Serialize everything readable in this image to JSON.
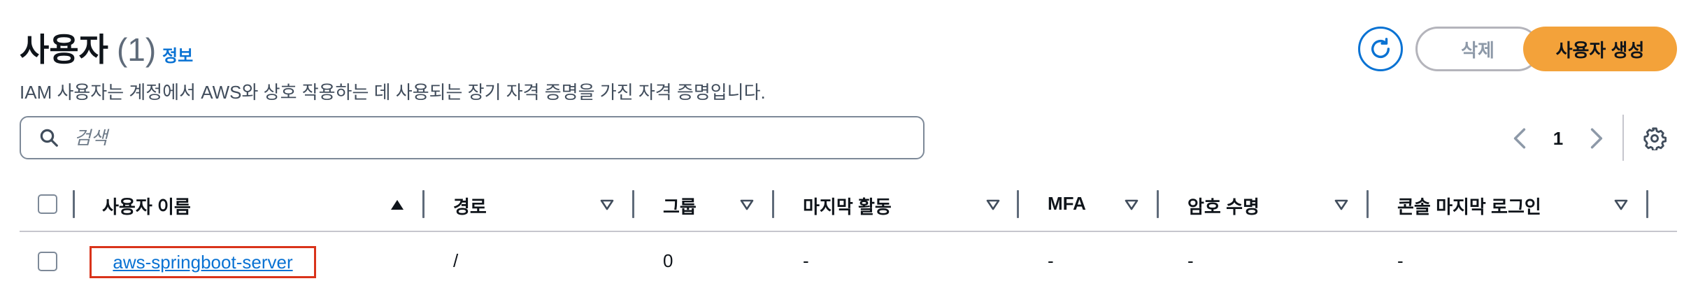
{
  "header": {
    "title": "사용자",
    "count": "(1)",
    "info_link": "정보",
    "description": "IAM 사용자는 계정에서 AWS와 상호 작용하는 데 사용되는 장기 자격 증명을 가진 자격 증명입니다.",
    "refresh_icon": "refresh-icon",
    "delete_label": "삭제",
    "create_label": "사용자 생성",
    "accent_color": "#0972d3",
    "primary_button_color": "#f3a23a"
  },
  "search": {
    "placeholder": "검색",
    "value": "",
    "icon": "search-icon"
  },
  "pagination": {
    "current_page": "1",
    "prev_icon": "chevron-left-icon",
    "next_icon": "chevron-right-icon",
    "settings_icon": "gear-icon"
  },
  "table": {
    "columns": [
      {
        "label": "사용자 이름",
        "sort": "ascending"
      },
      {
        "label": "경로",
        "sort": "none"
      },
      {
        "label": "그룹",
        "sort": "none"
      },
      {
        "label": "마지막 활동",
        "sort": "none"
      },
      {
        "label": "MFA",
        "sort": "none"
      },
      {
        "label": "암호 수명",
        "sort": "none"
      },
      {
        "label": "콘솔 마지막 로그인",
        "sort": "none"
      }
    ],
    "rows": [
      {
        "selected": false,
        "user_name": "aws-springboot-server",
        "path": "/",
        "groups": "0",
        "last_activity": "-",
        "mfa": "-",
        "password_age": "-",
        "console_last_login": "-"
      }
    ]
  }
}
